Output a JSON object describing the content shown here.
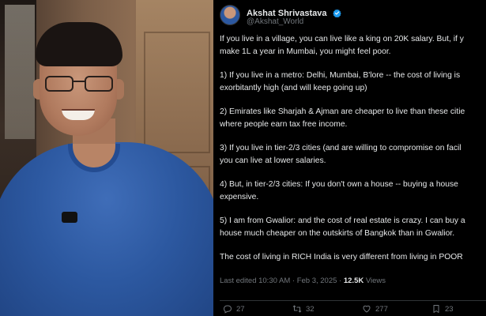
{
  "tweet": {
    "display_name": "Akshat Shrivastava",
    "handle": "@Akshat_World",
    "paragraphs": [
      [
        "If you live in a village, you can live like a king on 20K salary. But, if y",
        "make 1L a year in Mumbai, you might feel poor."
      ],
      [
        "1) If you live in a metro: Delhi, Mumbai, B'lore -- the cost of living is",
        "exorbitantly high (and will keep going up)"
      ],
      [
        "2) Emirates like Sharjah & Ajman are cheaper to live than these citie",
        "where people earn tax free income."
      ],
      [
        "3) If you live in tier-2/3 cities (and are willing to compromise on facil",
        "you can live at lower salaries."
      ],
      [
        "4) But, in tier-2/3 cities: If you don't own a house -- buying a house",
        "expensive."
      ],
      [
        "5) I am from Gwalior: and the cost of real estate is crazy. I can buy a",
        "house much cheaper on the outskirts of Bangkok than in Gwalior."
      ],
      [
        "The cost of living in RICH India is very different from living in POOR"
      ]
    ],
    "meta": {
      "edited": "Last edited 10:30 AM · Feb 3, 2025 · ",
      "views_count": "12.5K",
      "views_label": " Views"
    },
    "actions": {
      "replies": "27",
      "reposts": "32",
      "likes": "277",
      "bookmarks": "23"
    }
  },
  "colors": {
    "background": "#000000",
    "text": "#e7e9ea",
    "muted": "#71767b",
    "verified": "#1d9bf0"
  }
}
